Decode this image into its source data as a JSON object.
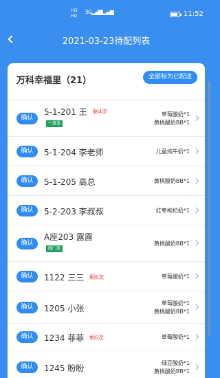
{
  "status_bar": {
    "sig_top": "HD",
    "sig_bottom": "HD",
    "net1": "5G",
    "net2": "4G",
    "time": "11:52"
  },
  "nav": {
    "title": "2021-03-23待配列表"
  },
  "group": {
    "name": "万科幸福里（21）",
    "mark_all_label": "全部标为已配送"
  },
  "rows": [
    {
      "confirm": "确认",
      "address": "5-1-201 王",
      "remaining": "剩4次",
      "tag": "一直送",
      "products": [
        "草莓酸奶*1",
        "黄桃酸奶BB*1"
      ]
    },
    {
      "confirm": "确认",
      "address": "5-1-204 李老师",
      "remaining": "",
      "tag": "",
      "products": [
        "儿童纯牛奶*1"
      ]
    },
    {
      "confirm": "确认",
      "address": "5-1-205 高总",
      "remaining": "",
      "tag": "",
      "products": [
        "黄桃酸奶BB*1"
      ]
    },
    {
      "confirm": "确认",
      "address": "5-2-203 李叔叔",
      "remaining": "",
      "tag": "",
      "products": [
        "红枣枸杞奶*1"
      ]
    },
    {
      "confirm": "确认",
      "address": "A座203 露露",
      "remaining": "",
      "tag": "敲门送",
      "products": [
        "黄桃酸奶BB*1"
      ]
    },
    {
      "confirm": "确认",
      "address": "1122 三三",
      "remaining": "剩6次",
      "tag": "",
      "products": [
        "草莓酸奶*1"
      ]
    },
    {
      "confirm": "确认",
      "address": "1205 小张",
      "remaining": "",
      "tag": "",
      "products": [
        "草莓酸奶*1",
        "黄桃酸奶BB*1"
      ]
    },
    {
      "confirm": "确认",
      "address": "1234 菲菲",
      "remaining": "剩6次",
      "tag": "",
      "products": [
        "草莓酸奶*1"
      ]
    },
    {
      "confirm": "确认",
      "address": "1245 盼盼",
      "remaining": "",
      "tag": "",
      "products": [
        "绿豆酸奶*1",
        "黄桃酸奶BB*1"
      ]
    }
  ]
}
